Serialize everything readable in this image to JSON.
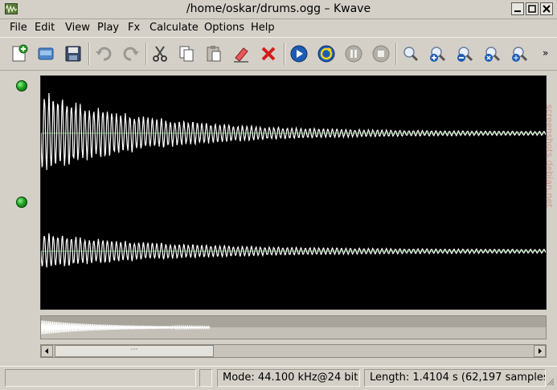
{
  "window": {
    "title": "/home/oskar/drums.ogg – Kwave",
    "app_icon": "kwave-app-icon",
    "buttons": [
      "minimize-icon",
      "maximize-icon",
      "close-icon"
    ]
  },
  "menu": {
    "items": [
      "File",
      "Edit",
      "View",
      "Play",
      "Fx",
      "Calculate",
      "Options",
      "Help"
    ]
  },
  "toolbar": {
    "buttons": [
      {
        "name": "new-file-icon"
      },
      {
        "name": "open-file-icon"
      },
      {
        "name": "save-icon"
      },
      {
        "name": "undo-icon"
      },
      {
        "name": "redo-icon"
      },
      {
        "name": "cut-icon"
      },
      {
        "name": "copy-icon"
      },
      {
        "name": "paste-icon"
      },
      {
        "name": "erase-icon"
      },
      {
        "name": "delete-icon"
      },
      {
        "name": "play-icon"
      },
      {
        "name": "loop-icon"
      },
      {
        "name": "pause-icon"
      },
      {
        "name": "stop-icon"
      },
      {
        "name": "zoom-icon"
      },
      {
        "name": "zoom-in-icon"
      },
      {
        "name": "zoom-out-icon"
      },
      {
        "name": "zoom-selection-icon"
      },
      {
        "name": "zoom-all-icon"
      }
    ],
    "more": "»"
  },
  "tracks": [
    {
      "name": "track-1",
      "enabled": true
    },
    {
      "name": "track-2",
      "enabled": true
    }
  ],
  "scrollbar": {
    "thumb_grip": "⋯"
  },
  "status": {
    "message": "",
    "mode": "Mode: 44.100 kHz@24 bit",
    "length": "Length: 1.4104 s (62,197 samples)"
  },
  "colors": {
    "window_bg": "#d4d0c8",
    "wave_bg": "#000000",
    "wave_line": "#ffffff",
    "zero_line": "#3fa63f",
    "led": "#1fa51f",
    "overview_bg": "#a8a49c"
  },
  "watermark": "screenshots.debian.net"
}
